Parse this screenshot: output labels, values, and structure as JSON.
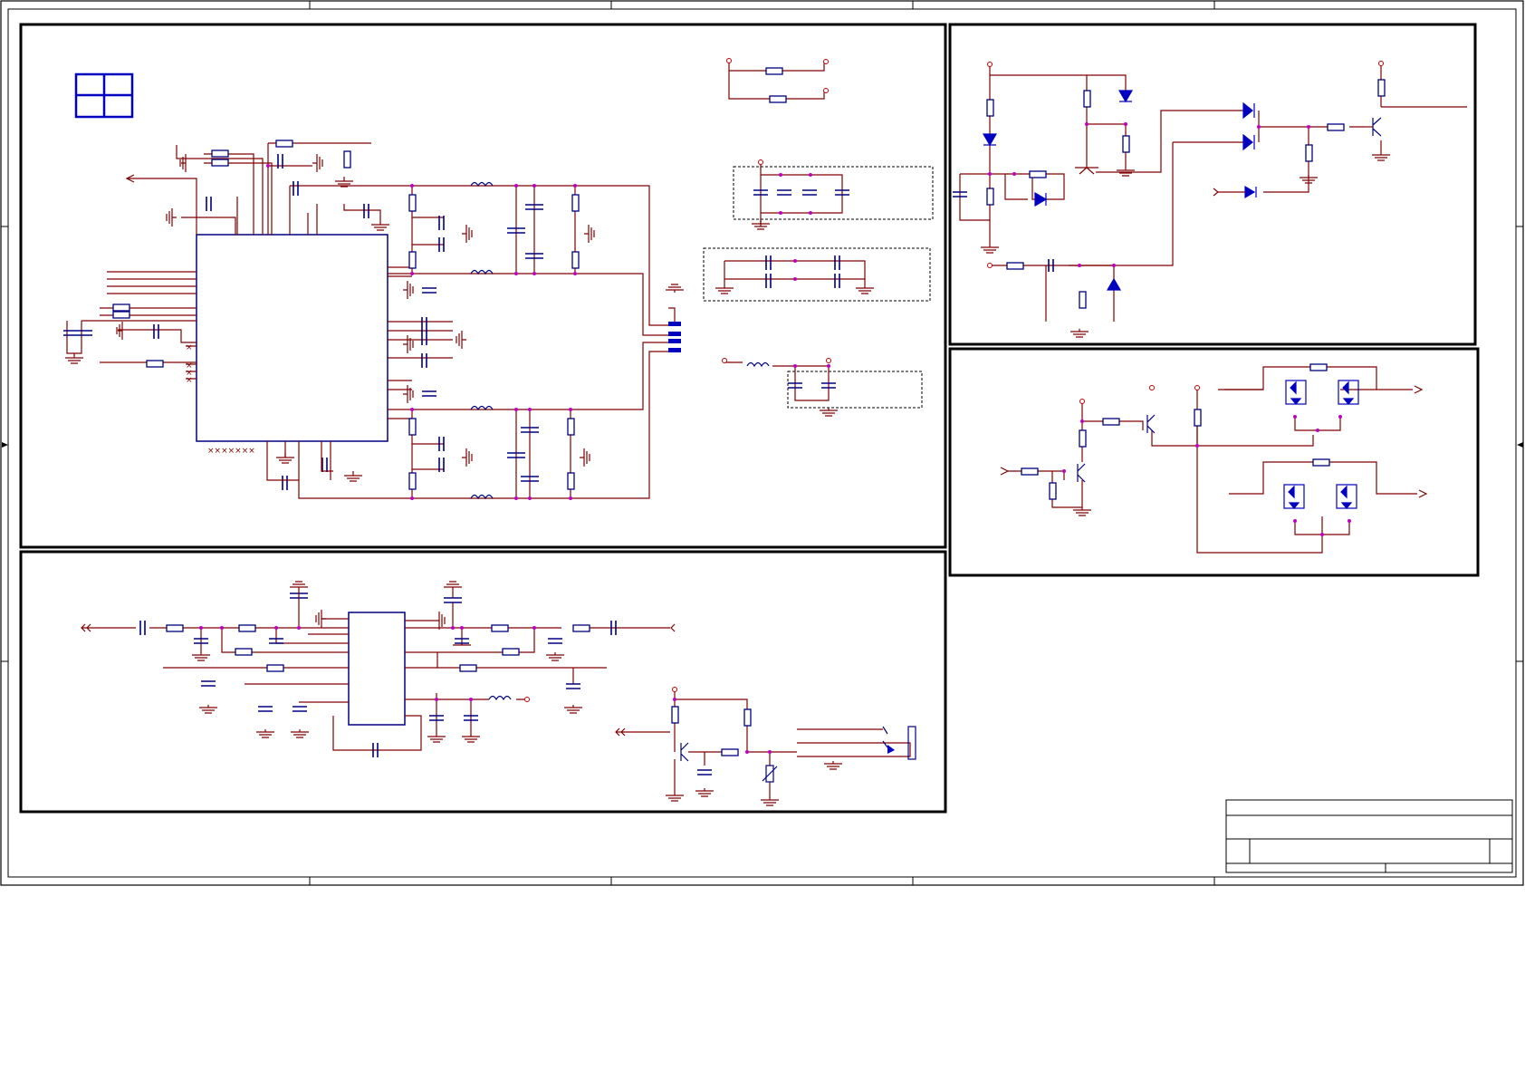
{
  "sheet": {
    "type": "electrical-schematic",
    "text_labels": []
  },
  "blocks": [
    {
      "id": "power-ic",
      "title": ""
    },
    {
      "id": "transistor-driver",
      "title": ""
    },
    {
      "id": "mosfet-switch",
      "title": ""
    },
    {
      "id": "opamp-filter",
      "title": ""
    }
  ],
  "title_block": {
    "title": "",
    "document_number": "",
    "revision": "",
    "size": "",
    "date": "",
    "sheet": ""
  },
  "colors": {
    "wire": "#800000",
    "component": "#000080",
    "junction": "#c000c0",
    "diode_fill": "#0000c0",
    "border": "#000000"
  }
}
